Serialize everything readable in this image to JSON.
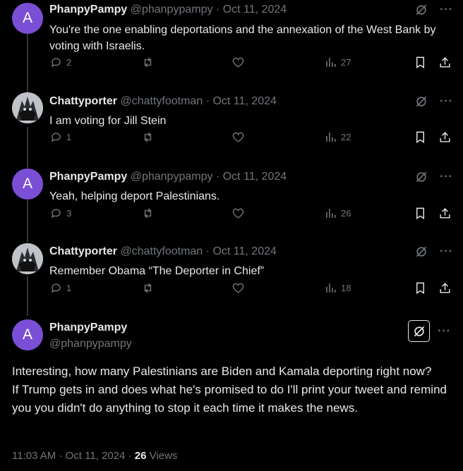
{
  "replies": [
    {
      "avatar_letter": "A",
      "avatar_type": "letter",
      "name": "PhanpyPampy",
      "handle": "@phanpypampy",
      "date": "Oct 11, 2024",
      "text": "You're the one enabling deportations and the annexation of the West Bank by voting with Israelis.",
      "replies": "2",
      "views": "27"
    },
    {
      "avatar_type": "photo",
      "name": "Chattyporter",
      "handle": "@chattyfootman",
      "date": "Oct 11, 2024",
      "text": "I am voting for Jill Stein",
      "replies": "1",
      "views": "22"
    },
    {
      "avatar_letter": "A",
      "avatar_type": "letter",
      "name": "PhanpyPampy",
      "handle": "@phanpypampy",
      "date": "Oct 11, 2024",
      "text": "Yeah, helping deport Palestinians.",
      "replies": "3",
      "views": "26"
    },
    {
      "avatar_type": "photo",
      "name": "Chattyporter",
      "handle": "@chattyfootman",
      "date": "Oct 11, 2024",
      "text": "Remember Obama “The Deporter in Chief”",
      "replies": "1",
      "views": "18"
    }
  ],
  "main": {
    "avatar_letter": "A",
    "name": "PhanpyPampy",
    "handle": "@phanpypampy",
    "body_line1": "Interesting, how many Palestinians are Biden and Kamala deporting right now?",
    "body_line2": "If Trump gets in and does what he's promised to do I'll print your tweet and remind you you didn't do anything to stop it each time it makes the news.",
    "time": "11:03 AM",
    "date": "Oct 11, 2024",
    "views_count": "26",
    "views_label": "Views"
  },
  "separator": "·",
  "more_label": "···",
  "icons": [
    "reply-icon",
    "repost-icon",
    "like-icon",
    "views-icon",
    "bookmark-icon",
    "share-icon",
    "grok-icon",
    "more-icon"
  ],
  "colors": {
    "background": "#000000",
    "text": "#e7e9ea",
    "muted": "#71767b",
    "avatar": "#7b4ed6"
  }
}
